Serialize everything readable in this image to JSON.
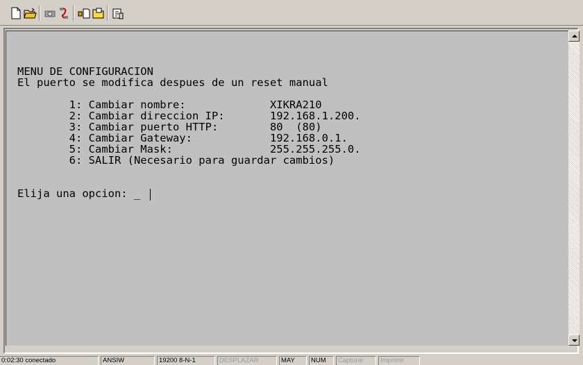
{
  "toolbar": {
    "buttons": [
      "new-icon",
      "open-icon",
      "disconnect-icon",
      "properties-connection-icon",
      "send-icon",
      "receive-icon",
      "properties-icon"
    ]
  },
  "terminal": {
    "lines": [
      "MENU DE CONFIGURACION",
      "El puerto se modifica despues de un reset manual",
      "",
      "        1: Cambiar nombre:             XIKRA210",
      "        2: Cambiar direccion IP:       192.168.1.200.",
      "        3: Cambiar puerto HTTP:        80  (80)",
      "        4: Cambiar Gateway:            192.168.0.1.",
      "        5: Cambiar Mask:               255.255.255.0.",
      "        6: SALIR (Necesario para guardar cambios)",
      "",
      "Elija una opcion: _"
    ]
  },
  "statusbar": {
    "connection": "0:02:30 conectado",
    "emulation": "ANSIW",
    "port_settings": "19200 8-N-1",
    "scroll": "DESPLAZAR",
    "caps": "MAY",
    "num": "NUM",
    "capture": "Capturar",
    "print": "Imprimir"
  },
  "colors": {
    "terminal_bg": "#c0c0c0",
    "chrome": "#d4d0c8",
    "text": "#000000"
  }
}
